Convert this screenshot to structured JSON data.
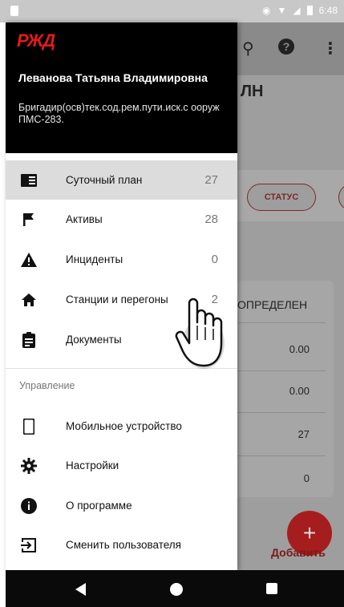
{
  "status_bar": {
    "time": "6:48"
  },
  "background": {
    "title_partial": "ЛН",
    "chip_status": "СТАТУС",
    "card_header": "ОПРЕДЕЛЕН",
    "card_values": [
      "0.00",
      "0.00",
      "27",
      "0"
    ],
    "add_label": "Добавить"
  },
  "drawer": {
    "logo": "РЖД",
    "user_name": "Леванова Татьяна Владимировна",
    "user_role": "Бригадир(осв)тек.сод.рем.пути.иск.с ооруж\nПМС-283.",
    "main_items": [
      {
        "label": "Суточный план",
        "count": "27",
        "icon": "daily-plan-icon",
        "active": true
      },
      {
        "label": "Активы",
        "count": "28",
        "icon": "flag-icon",
        "active": false
      },
      {
        "label": "Инциденты",
        "count": "0",
        "icon": "warning-icon",
        "active": false
      },
      {
        "label": "Станции и перегоны",
        "count": "2",
        "icon": "home-icon",
        "active": false
      },
      {
        "label": "Документы",
        "count": "",
        "icon": "clipboard-icon",
        "active": false
      }
    ],
    "section_label": "Управление",
    "manage_items": [
      {
        "label": "Мобильное устройство",
        "icon": "phone-icon"
      },
      {
        "label": "Настройки",
        "icon": "gear-icon"
      },
      {
        "label": "О программе",
        "icon": "info-icon"
      },
      {
        "label": "Сменить пользователя",
        "icon": "switch-user-icon"
      }
    ]
  }
}
